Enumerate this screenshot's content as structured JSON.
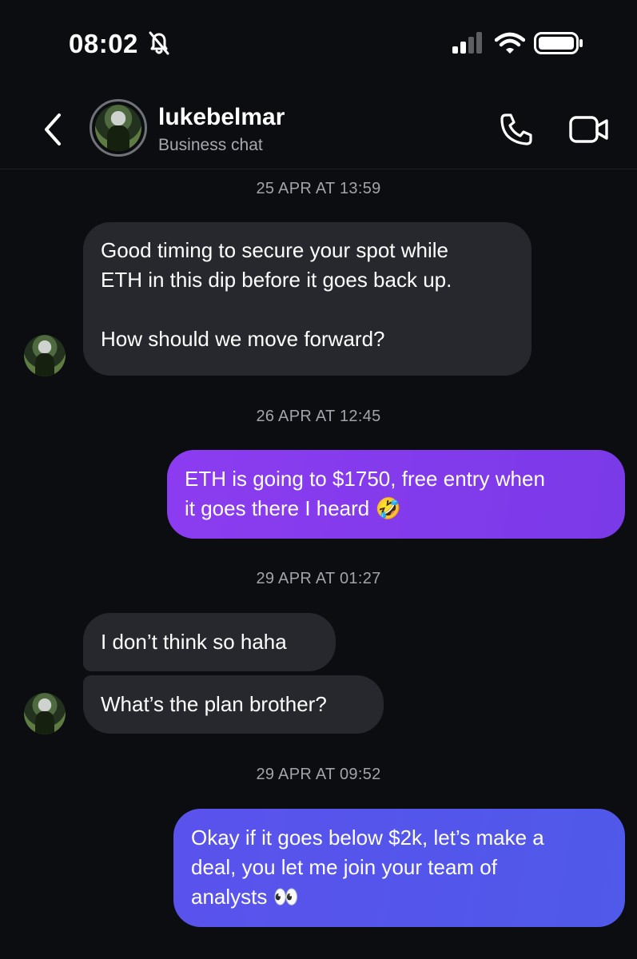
{
  "status_bar": {
    "time": "08:02",
    "icons": [
      "bell-slash-icon",
      "cellular-signal-icon",
      "wifi-icon",
      "battery-icon"
    ]
  },
  "header": {
    "back_icon": "chevron-left-icon",
    "username": "lukebelmar",
    "subtitle": "Business chat",
    "call_icon": "phone-icon",
    "video_icon": "video-camera-icon"
  },
  "colors": {
    "background": "#0c0d10",
    "incoming_bubble": "#26282d",
    "outgoing_purple": "#8c3cf0",
    "outgoing_blue": "#5153ea",
    "timestamp_text": "#a1a4aa"
  },
  "conversation": {
    "timestamps": [
      "25 APR AT 13:59",
      "26 APR AT 12:45",
      "29 APR AT 01:27",
      "29 APR AT 09:52"
    ],
    "messages": [
      {
        "direction": "incoming",
        "lines": [
          "Good timing to secure your spot while",
          "ETH in this dip before it goes back up.",
          "",
          "How should we move forward?"
        ]
      },
      {
        "direction": "outgoing",
        "lines": [
          "ETH is going to $1750, free entry when",
          "it goes there I heard"
        ],
        "emoji": "🤣"
      },
      {
        "direction": "incoming",
        "lines": [
          "I don’t think so haha"
        ]
      },
      {
        "direction": "incoming",
        "lines": [
          "What’s the plan brother?"
        ]
      },
      {
        "direction": "outgoing",
        "lines": [
          "Okay if it goes below $2k, let’s make a",
          "deal, you let me join your team of",
          "analysts"
        ],
        "emoji": "👀"
      }
    ]
  }
}
